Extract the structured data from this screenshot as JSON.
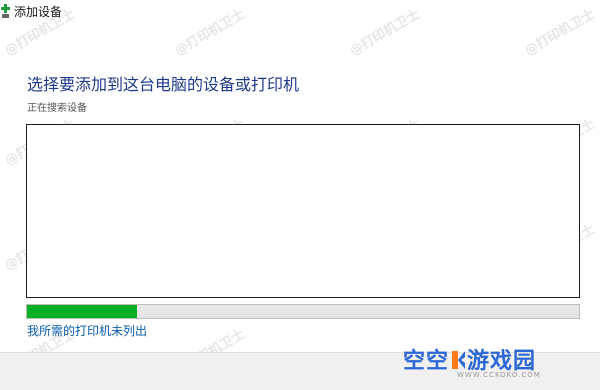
{
  "window": {
    "title": "添加设备"
  },
  "main": {
    "heading": "选择要添加到这台电脑的设备或打印机",
    "status": "正在搜索设备",
    "progress_fraction": 0.2,
    "missing_printer_link": "我所需的打印机未列出"
  },
  "watermark": {
    "text": "@打印机卫士"
  },
  "brand": {
    "name_left": "空空",
    "name_right": "游戏园",
    "url": "WWW.CCKOKO.COM"
  },
  "colors": {
    "heading": "#1f3a8a",
    "link": "#0b5cad",
    "progress_fill": "#06b025",
    "brand": "#2b67d6"
  }
}
